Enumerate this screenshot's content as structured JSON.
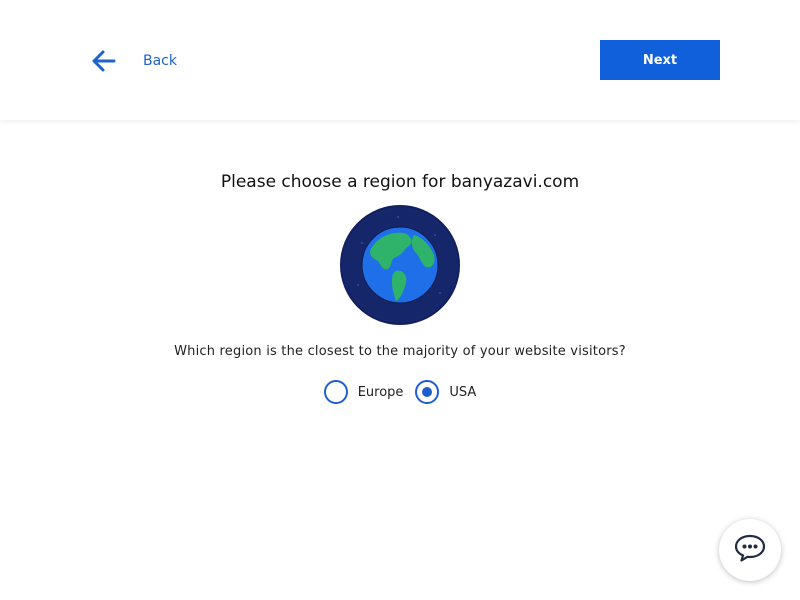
{
  "header": {
    "back_label": "Back",
    "next_label": "Next"
  },
  "main": {
    "title": "Please choose a region for banyazavi.com",
    "question": "Which region is the closest to the majority of your website visitors?",
    "regions": [
      {
        "label": "Europe",
        "selected": false
      },
      {
        "label": "USA",
        "selected": true
      }
    ]
  },
  "icons": {
    "back": "arrow-left-icon",
    "globe": "globe-icon",
    "chat": "chat-bubble-icon"
  },
  "colors": {
    "accent": "#1060dc",
    "radio": "#1e5fcf",
    "globe_bg": "#13205e",
    "ocean": "#1e6fe8",
    "land": "#2fb36a"
  }
}
